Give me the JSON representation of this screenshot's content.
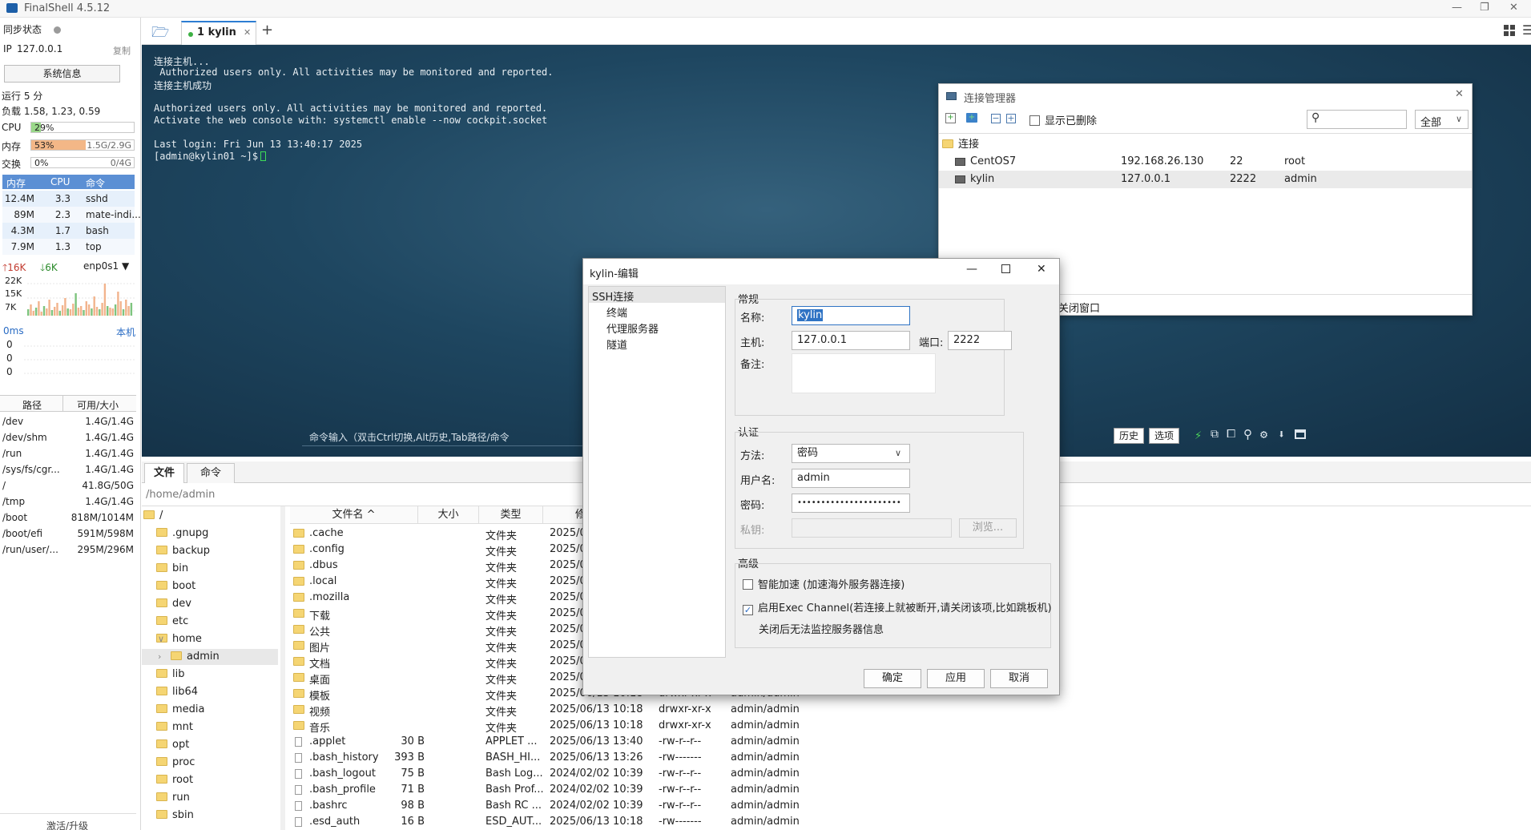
{
  "window": {
    "title": "FinalShell 4.5.12"
  },
  "sync": {
    "label": "同步状态"
  },
  "ip": {
    "label": "IP",
    "value": "127.0.0.1",
    "copy": "复制"
  },
  "sysinfo_btn": "系统信息",
  "uptime": "运行 5 分",
  "load": "负载 1.58, 1.23, 0.59",
  "cpu": {
    "label": "CPU",
    "text": "29%",
    "percent": 29
  },
  "mem": {
    "label": "内存",
    "text": "53%",
    "size": "1.5G/2.9G",
    "percent": 53
  },
  "swap": {
    "label": "交换",
    "text": "0%",
    "size": "0/4G",
    "percent": 0
  },
  "proc_headers": [
    "内存",
    "CPU",
    "命令"
  ],
  "procs": [
    {
      "mem": "12.4M",
      "cpu": "3.3",
      "cmd": "sshd"
    },
    {
      "mem": "89M",
      "cpu": "2.3",
      "cmd": "mate-indi..."
    },
    {
      "mem": "4.3M",
      "cpu": "1.7",
      "cmd": "bash"
    },
    {
      "mem": "7.9M",
      "cpu": "1.3",
      "cmd": "top"
    }
  ],
  "net": {
    "up": "16K",
    "down": "6K",
    "iface": "enp0s1",
    "y_labels": [
      "22K",
      "15K",
      "7K"
    ]
  },
  "latency": {
    "value": "0ms",
    "target": "本机",
    "vals": [
      "0",
      "0",
      "0"
    ]
  },
  "disk_headers": [
    "路径",
    "可用/大小"
  ],
  "disks": [
    {
      "path": "/dev",
      "size": "1.4G/1.4G"
    },
    {
      "path": "/dev/shm",
      "size": "1.4G/1.4G"
    },
    {
      "path": "/run",
      "size": "1.4G/1.4G"
    },
    {
      "path": "/sys/fs/cgr...",
      "size": "1.4G/1.4G"
    },
    {
      "path": "/",
      "size": "41.8G/50G"
    },
    {
      "path": "/tmp",
      "size": "1.4G/1.4G"
    },
    {
      "path": "/boot",
      "size": "818M/1014M"
    },
    {
      "path": "/boot/efi",
      "size": "591M/598M"
    },
    {
      "path": "/run/user/...",
      "size": "295M/296M"
    }
  ],
  "activate": "激活/升级",
  "tab": {
    "label": "1 kylin"
  },
  "terminal": {
    "lines": [
      "连接主机...",
      " Authorized users only. All activities may be monitored and reported.",
      "连接主机成功",
      "",
      "Authorized users only. All activities may be monitored and reported.",
      "Activate the web console with: systemctl enable --now cockpit.socket",
      "",
      "Last login: Fri Jun 13 13:40:17 2025",
      "[admin@kylin01 ~]$ "
    ],
    "cmd_placeholder": "命令输入（双击Ctrl切换,Alt历史,Tab路径/命令",
    "history_btn": "历史",
    "options_btn": "选项"
  },
  "bottom_tabs": [
    "文件",
    "命令"
  ],
  "path": "/home/admin",
  "tree": [
    {
      "name": "/",
      "indent": 0,
      "expander": ""
    },
    {
      "name": ".gnupg",
      "indent": 1,
      "expander": ""
    },
    {
      "name": "backup",
      "indent": 1,
      "expander": ""
    },
    {
      "name": "bin",
      "indent": 1,
      "expander": ""
    },
    {
      "name": "boot",
      "indent": 1,
      "expander": ""
    },
    {
      "name": "dev",
      "indent": 1,
      "expander": ""
    },
    {
      "name": "etc",
      "indent": 1,
      "expander": ""
    },
    {
      "name": "home",
      "indent": 1,
      "expander": "∨"
    },
    {
      "name": "admin",
      "indent": 2,
      "expander": "›"
    },
    {
      "name": "lib",
      "indent": 1,
      "expander": ""
    },
    {
      "name": "lib64",
      "indent": 1,
      "expander": ""
    },
    {
      "name": "media",
      "indent": 1,
      "expander": ""
    },
    {
      "name": "mnt",
      "indent": 1,
      "expander": ""
    },
    {
      "name": "opt",
      "indent": 1,
      "expander": ""
    },
    {
      "name": "proc",
      "indent": 1,
      "expander": ""
    },
    {
      "name": "root",
      "indent": 1,
      "expander": ""
    },
    {
      "name": "run",
      "indent": 1,
      "expander": ""
    },
    {
      "name": "sbin",
      "indent": 1,
      "expander": ""
    }
  ],
  "file_headers": {
    "name": "文件名 ^",
    "size": "大小",
    "type": "类型",
    "mtime": "修"
  },
  "files": [
    {
      "name": ".cache",
      "size": "",
      "type": "文件夹",
      "mtime": "2025/0",
      "perm": "",
      "owner": "",
      "folder": true
    },
    {
      "name": ".config",
      "size": "",
      "type": "文件夹",
      "mtime": "2025/0",
      "perm": "",
      "owner": "",
      "folder": true
    },
    {
      "name": ".dbus",
      "size": "",
      "type": "文件夹",
      "mtime": "2025/0",
      "perm": "",
      "owner": "",
      "folder": true
    },
    {
      "name": ".local",
      "size": "",
      "type": "文件夹",
      "mtime": "2025/0",
      "perm": "",
      "owner": "",
      "folder": true
    },
    {
      "name": ".mozilla",
      "size": "",
      "type": "文件夹",
      "mtime": "2025/0",
      "perm": "",
      "owner": "",
      "folder": true
    },
    {
      "name": "下载",
      "size": "",
      "type": "文件夹",
      "mtime": "2025/0",
      "perm": "",
      "owner": "",
      "folder": true
    },
    {
      "name": "公共",
      "size": "",
      "type": "文件夹",
      "mtime": "2025/0",
      "perm": "",
      "owner": "",
      "folder": true
    },
    {
      "name": "图片",
      "size": "",
      "type": "文件夹",
      "mtime": "2025/0",
      "perm": "",
      "owner": "",
      "folder": true
    },
    {
      "name": "文档",
      "size": "",
      "type": "文件夹",
      "mtime": "2025/0",
      "perm": "",
      "owner": "",
      "folder": true
    },
    {
      "name": "桌面",
      "size": "",
      "type": "文件夹",
      "mtime": "2025/0",
      "perm": "",
      "owner": "",
      "folder": true
    },
    {
      "name": "模板",
      "size": "",
      "type": "文件夹",
      "mtime": "2025/06/13 10:18",
      "perm": "drwxr-xr-x",
      "owner": "admin/admin",
      "folder": true
    },
    {
      "name": "视频",
      "size": "",
      "type": "文件夹",
      "mtime": "2025/06/13 10:18",
      "perm": "drwxr-xr-x",
      "owner": "admin/admin",
      "folder": true
    },
    {
      "name": "音乐",
      "size": "",
      "type": "文件夹",
      "mtime": "2025/06/13 10:18",
      "perm": "drwxr-xr-x",
      "owner": "admin/admin",
      "folder": true
    },
    {
      "name": ".applet",
      "size": "30 B",
      "type": "APPLET ...",
      "mtime": "2025/06/13 13:40",
      "perm": "-rw-r--r--",
      "owner": "admin/admin",
      "folder": false
    },
    {
      "name": ".bash_history",
      "size": "393 B",
      "type": "BASH_HI...",
      "mtime": "2025/06/13 13:26",
      "perm": "-rw-------",
      "owner": "admin/admin",
      "folder": false
    },
    {
      "name": ".bash_logout",
      "size": "75 B",
      "type": "Bash Log...",
      "mtime": "2024/02/02 10:39",
      "perm": "-rw-r--r--",
      "owner": "admin/admin",
      "folder": false
    },
    {
      "name": ".bash_profile",
      "size": "71 B",
      "type": "Bash Prof...",
      "mtime": "2024/02/02 10:39",
      "perm": "-rw-r--r--",
      "owner": "admin/admin",
      "folder": false
    },
    {
      "name": ".bashrc",
      "size": "98 B",
      "type": "Bash RC ...",
      "mtime": "2024/02/02 10:39",
      "perm": "-rw-r--r--",
      "owner": "admin/admin",
      "folder": false
    },
    {
      "name": ".esd_auth",
      "size": "16 B",
      "type": "ESD_AUT...",
      "mtime": "2025/06/13 10:18",
      "perm": "-rw-------",
      "owner": "admin/admin",
      "folder": false
    }
  ],
  "conn_mgr": {
    "title": "连接管理器",
    "show_deleted": "显示已删除",
    "filter": "全部",
    "root": "连接",
    "items": [
      {
        "name": "CentOS7",
        "host": "192.168.26.130",
        "port": "22",
        "user": "root"
      },
      {
        "name": "kylin",
        "host": "127.0.0.1",
        "port": "2222",
        "user": "admin"
      }
    ],
    "close_hint": "关闭窗口"
  },
  "edit_dialog": {
    "title": "kylin-编辑",
    "nav": [
      "SSH连接",
      "终端",
      "代理服务器",
      "隧道"
    ],
    "general": "常规",
    "name_label": "名称:",
    "name_value": "kylin",
    "host_label": "主机:",
    "host_value": "127.0.0.1",
    "port_label": "端口:",
    "port_value": "2222",
    "note_label": "备注:",
    "auth": "认证",
    "method_label": "方法:",
    "method_value": "密码",
    "user_label": "用户名:",
    "user_value": "admin",
    "pass_label": "密码:",
    "pass_value": "••••••••••••••••••••••",
    "key_label": "私钥:",
    "browse": "浏览...",
    "advanced": "高级",
    "accel": "智能加速 (加速海外服务器连接)",
    "exec": "启用Exec Channel(若连接上就被断开,请关闭该项,比如跳板机)",
    "exec_note": "关闭后无法监控服务器信息",
    "ok": "确定",
    "apply": "应用",
    "cancel": "取消"
  }
}
